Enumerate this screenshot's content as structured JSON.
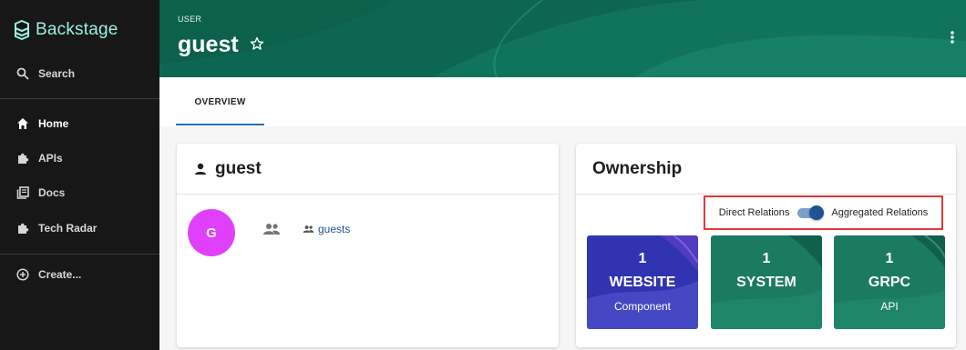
{
  "sidebar": {
    "app_name": "Backstage",
    "search_label": "Search",
    "items": [
      {
        "label": "Home",
        "icon": "home-icon"
      },
      {
        "label": "APIs",
        "icon": "puzzle-icon"
      },
      {
        "label": "Docs",
        "icon": "library-icon"
      },
      {
        "label": "Tech Radar",
        "icon": "puzzle-icon"
      }
    ],
    "create_label": "Create..."
  },
  "header": {
    "type_label": "USER",
    "title": "guest",
    "star_icon": "star-outline-icon",
    "menu_icon": "kebab-menu-icon"
  },
  "tabs": [
    {
      "label": "OVERVIEW",
      "selected": true
    }
  ],
  "user_card": {
    "title": "guest",
    "avatar_initial": "G",
    "avatar_color": "#e040fb",
    "group_link": "guests"
  },
  "ownership_card": {
    "title": "Ownership",
    "toggle": {
      "left_label": "Direct Relations",
      "right_label": "Aggregated Relations",
      "aggregated": true
    },
    "tiles": [
      {
        "count": "1",
        "name": "WEBSITE",
        "kind": "Component"
      },
      {
        "count": "1",
        "name": "SYSTEM",
        "kind": ""
      },
      {
        "count": "1",
        "name": "GRPC",
        "kind": "API"
      }
    ]
  },
  "colors": {
    "sidebar_bg": "#171717",
    "brand_teal": "#9bf0e1",
    "header_bg": "#0f6b57",
    "link": "#1f5493",
    "highlight_border": "#e03a3a"
  }
}
